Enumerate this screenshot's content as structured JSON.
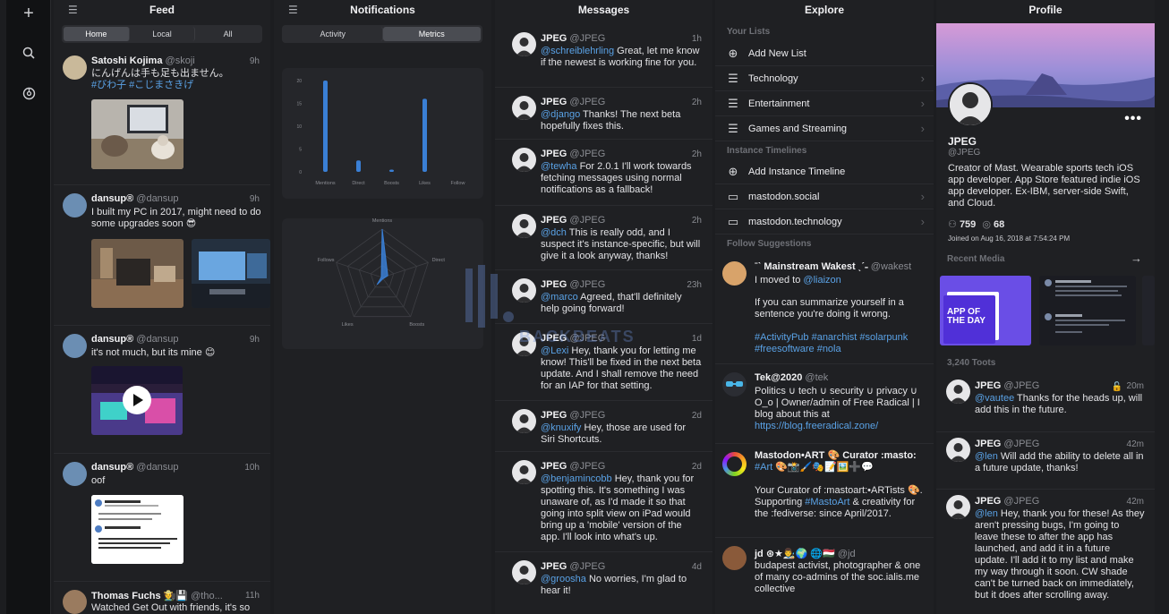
{
  "rail": {
    "icons": [
      "plus-icon",
      "search-icon",
      "settings-icon"
    ]
  },
  "feed": {
    "title": "Feed",
    "tabs": [
      {
        "label": "Home",
        "active": true
      },
      {
        "label": "Local",
        "active": false
      },
      {
        "label": "All",
        "active": false
      }
    ],
    "posts": [
      {
        "name": "Satoshi Kojima",
        "handle": "@skoji",
        "time": "9h",
        "text": "にんげんは手も足も出ません。",
        "tags": "#びわ子 #こじまさきげ"
      },
      {
        "name": "dansup®",
        "handle": "@dansup",
        "time": "9h",
        "text": "I built my PC in 2017, might need to do some upgrades soon 😎"
      },
      {
        "name": "dansup®",
        "handle": "@dansup",
        "time": "9h",
        "text": "it's not much, but its mine 😊"
      },
      {
        "name": "dansup®",
        "handle": "@dansup",
        "time": "10h",
        "text": "oof"
      },
      {
        "name": "Thomas Fuchs 🧑‍🌾💾",
        "handle": "@tho...",
        "time": "11h",
        "text": "Watched Get Out with friends, it's so"
      }
    ]
  },
  "notifications": {
    "title": "Notifications",
    "tabs": [
      {
        "label": "Activity",
        "active": false
      },
      {
        "label": "Metrics",
        "active": true
      }
    ],
    "bar_chart": {
      "y_ticks": [
        "20",
        "15",
        "10",
        "5",
        "0"
      ],
      "categories": [
        "Mentions",
        "Direct",
        "Boosts",
        "Likes",
        "Follow"
      ],
      "values": [
        20,
        2.5,
        0.5,
        16,
        0
      ],
      "ylim": [
        0,
        20
      ],
      "color": "#3a7fd5"
    },
    "radar_chart": {
      "axes": [
        "Mentions",
        "Direct",
        "Boosts",
        "Likes",
        "Follows"
      ],
      "values": [
        1.0,
        0.12,
        0.03,
        0.18,
        0.02
      ],
      "color": "#3a7fd5"
    }
  },
  "messages": {
    "title": "Messages",
    "items": [
      {
        "name": "JPEG",
        "handle": "@JPEG",
        "time": "1h",
        "mention": "@schreiblehrling",
        "text": " Great, let me know if the newest is working fine for you."
      },
      {
        "name": "JPEG",
        "handle": "@JPEG",
        "time": "2h",
        "mention": "@django",
        "text": " Thanks! The next beta hopefully fixes this."
      },
      {
        "name": "JPEG",
        "handle": "@JPEG",
        "time": "2h",
        "mention": "@tewha",
        "text": " For 2.0.1 I'll work towards fetching messages using normal notifications as a fallback!"
      },
      {
        "name": "JPEG",
        "handle": "@JPEG",
        "time": "2h",
        "mention": "@dch",
        "text": " This is really odd, and I suspect it's instance-specific, but will give it a look anyway, thanks!"
      },
      {
        "name": "JPEG",
        "handle": "@JPEG",
        "time": "23h",
        "mention": "@marco",
        "text": " Agreed, that'll definitely help going forward!"
      },
      {
        "name": "JPEG",
        "handle": "@JPEG",
        "time": "1d",
        "mention": "@Lexi",
        "text": " Hey, thank you for letting me know! This'll be fixed in the next beta update. And I shall remove the need for an IAP for that setting."
      },
      {
        "name": "JPEG",
        "handle": "@JPEG",
        "time": "2d",
        "mention": "@knuxify",
        "text": " Hey, those are used for Siri Shortcuts."
      },
      {
        "name": "JPEG",
        "handle": "@JPEG",
        "time": "2d",
        "mention": "@benjamincobb",
        "text": " Hey, thank you for spotting this. It's something I was unaware of, as I'd made it so that going into split view on iPad would bring up a 'mobile' version of the app. I'll look into what's up."
      },
      {
        "name": "JPEG",
        "handle": "@JPEG",
        "time": "4d",
        "mention": "@groosha",
        "text": " No worries, I'm glad to hear it!"
      }
    ]
  },
  "explore": {
    "title": "Explore",
    "section_lists": "Your Lists",
    "lists": [
      {
        "label": "Add New List",
        "icon": "plus-circle-icon",
        "chevron": false
      },
      {
        "label": "Technology",
        "icon": "list-icon",
        "chevron": true
      },
      {
        "label": "Entertainment",
        "icon": "list-icon",
        "chevron": true
      },
      {
        "label": "Games and Streaming",
        "icon": "list-icon",
        "chevron": true
      }
    ],
    "section_instances": "Instance Timelines",
    "instances": [
      {
        "label": "Add Instance Timeline",
        "icon": "plus-circle-icon",
        "chevron": false
      },
      {
        "label": "mastodon.social",
        "icon": "chat-icon",
        "chevron": true
      },
      {
        "label": "mastodon.technology",
        "icon": "chat-icon",
        "chevron": true
      }
    ],
    "section_suggestions": "Follow Suggestions",
    "suggestions": [
      {
        "name": "ˉˋ Mainstream Wakest ˎˊ˗",
        "handle": "@wakest",
        "line1": "I moved to ",
        "link1": "@liaizon",
        "line2": "If you can summarize yourself in a sentence you're doing it wrong.",
        "tags": "#ActivityPub #anarchist #solarpunk #freesoftware #nola"
      },
      {
        "name": "Tek@2020",
        "handle": "@tek",
        "line1": "Politics ∪ tech ∪ security ∪ privacy ∪ O_o | Owner/admin of Free Radical | I blog about this at ",
        "link1": "https://blog.freeradical.zone/"
      },
      {
        "name": "Mastodon•ART 🎨 Curator :masto:",
        "handle": "",
        "line1": "#Art 🎨📸🖌️🎭📝🖼️➕💬",
        "line2": "Your Curator of :mastoart:•ARTists 🎨. Supporting ",
        "link2": "#MastoArt",
        "line3": " & creativity for the :fediverse: since April/2017."
      },
      {
        "name": "jd ⊛★👨‍🎨🌍 🌐🇭🇺",
        "handle": "@jd",
        "line1": "budapest activist, photographer & one of many co-admins of the soc.ialis.me collective"
      }
    ]
  },
  "profile": {
    "title": "Profile",
    "name": "JPEG",
    "handle": "@JPEG",
    "bio": "Creator of Mast. Wearable sports tech iOS app developer. App Store featured indie iOS app developer. Ex-IBM, server-side Swift, and Cloud.",
    "following": "759",
    "followers": "68",
    "joined": "Joined on Aug 16, 2018 at 7:54:24 PM",
    "recent_media_label": "Recent Media",
    "app_of_day": "APP OF THE DAY",
    "toots_label": "3,240 Toots",
    "toots": [
      {
        "name": "JPEG",
        "handle": "@JPEG",
        "time": "20m",
        "mention": "@vautee",
        "text": " Thanks for the heads up, will add this in the future."
      },
      {
        "name": "JPEG",
        "handle": "@JPEG",
        "time": "42m",
        "mention": "@len",
        "text": " Will add the ability to delete all in a future update, thanks!"
      },
      {
        "name": "JPEG",
        "handle": "@JPEG",
        "time": "42m",
        "mention": "@len",
        "text": " Hey, thank you for these! As they aren't pressing bugs, I'm going to leave these to after the app has launched, and add it in a future update. I'll add it to my list and make my way through it soon. CW shade can't be turned back on immediately, but it does after scrolling away."
      }
    ]
  },
  "watermark": "BACKBEATS"
}
